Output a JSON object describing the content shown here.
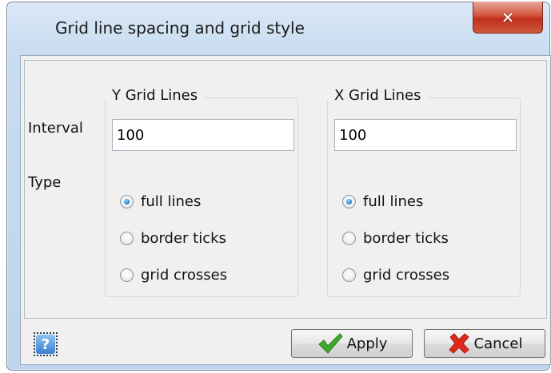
{
  "window": {
    "title": "Grid line spacing and grid style",
    "close_glyph": "✕"
  },
  "labels": {
    "interval": "Interval",
    "type": "Type"
  },
  "groups": [
    {
      "title": "Y Grid Lines",
      "interval_value": "100",
      "options": [
        {
          "label": "full lines",
          "checked": true
        },
        {
          "label": "border ticks",
          "checked": false
        },
        {
          "label": "grid crosses",
          "checked": false
        }
      ]
    },
    {
      "title": "X Grid Lines",
      "interval_value": "100",
      "options": [
        {
          "label": "full lines",
          "checked": true
        },
        {
          "label": "border ticks",
          "checked": false
        },
        {
          "label": "grid crosses",
          "checked": false
        }
      ]
    }
  ],
  "footer": {
    "help_glyph": "?",
    "apply_label": "Apply",
    "cancel_label": "Cancel"
  },
  "icons": {
    "close": "close-icon",
    "help": "help-icon",
    "apply": "checkmark-icon",
    "cancel": "red-x-icon"
  },
  "colors": {
    "title_bar": "#c9dcf0",
    "close_button": "#c0301c",
    "radio_selected": "#2e8ad8",
    "apply_check": "#3fa82a",
    "cancel_x": "#e0281c"
  }
}
